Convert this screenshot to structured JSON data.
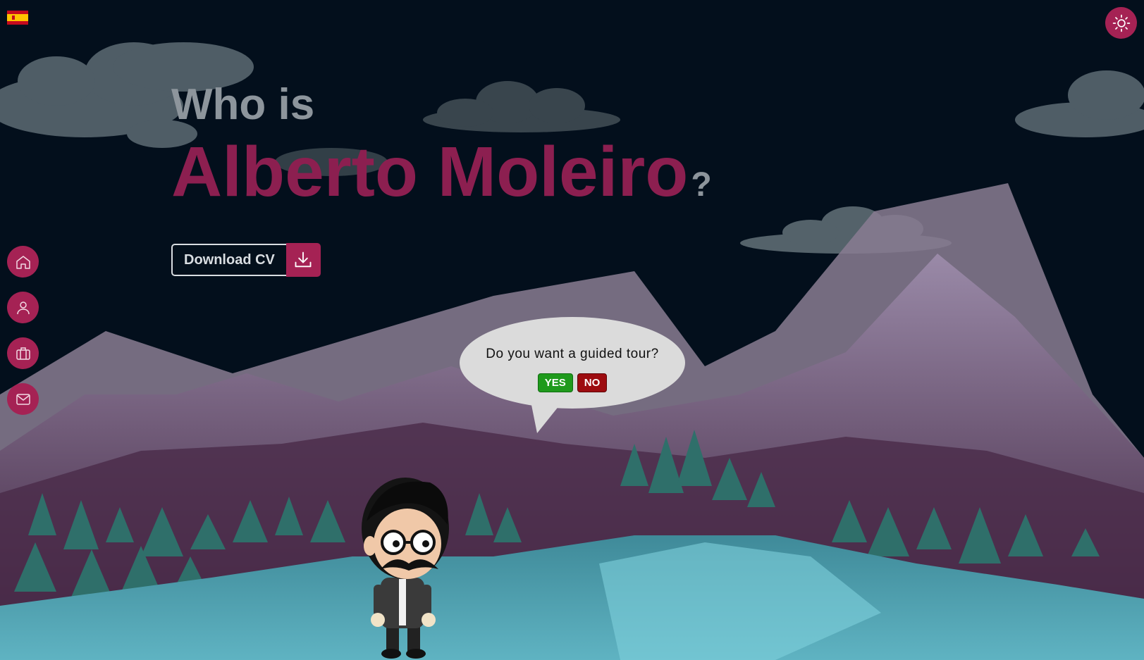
{
  "lang_flag": {
    "icon": "spain-flag-icon"
  },
  "theme_toggle": {
    "icon": "sun-icon"
  },
  "hero": {
    "who_is": "Who is",
    "name": "Alberto Moleiro",
    "question_mark": "?"
  },
  "cv": {
    "label": "Download CV",
    "icon": "download-icon"
  },
  "nav": {
    "items": [
      {
        "icon": "home-icon"
      },
      {
        "icon": "user-icon"
      },
      {
        "icon": "briefcase-icon"
      },
      {
        "icon": "mail-icon"
      }
    ]
  },
  "tour": {
    "question": "Do you want a guided tour?",
    "yes": "YES",
    "no": "NO"
  },
  "colors": {
    "background": "#030f1c",
    "accent": "#a52254",
    "name": "#8c1f50",
    "muted_text": "#8d959c"
  }
}
